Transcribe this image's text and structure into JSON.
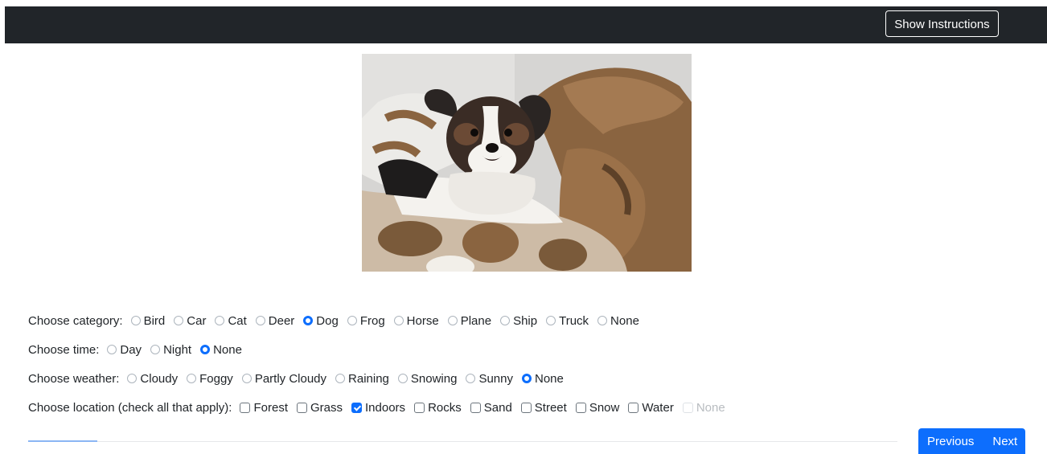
{
  "header": {
    "instructions_button": "Show Instructions"
  },
  "image": {
    "subject": "dog lying on brown blanket"
  },
  "questions": [
    {
      "label": "Choose category:",
      "type": "radio",
      "options": [
        {
          "text": "Bird",
          "checked": false
        },
        {
          "text": "Car",
          "checked": false
        },
        {
          "text": "Cat",
          "checked": false
        },
        {
          "text": "Deer",
          "checked": false
        },
        {
          "text": "Dog",
          "checked": true
        },
        {
          "text": "Frog",
          "checked": false
        },
        {
          "text": "Horse",
          "checked": false
        },
        {
          "text": "Plane",
          "checked": false
        },
        {
          "text": "Ship",
          "checked": false
        },
        {
          "text": "Truck",
          "checked": false
        },
        {
          "text": "None",
          "checked": false
        }
      ]
    },
    {
      "label": "Choose time:",
      "type": "radio",
      "options": [
        {
          "text": "Day",
          "checked": false
        },
        {
          "text": "Night",
          "checked": false
        },
        {
          "text": "None",
          "checked": true
        }
      ]
    },
    {
      "label": "Choose weather:",
      "type": "radio",
      "options": [
        {
          "text": "Cloudy",
          "checked": false
        },
        {
          "text": "Foggy",
          "checked": false
        },
        {
          "text": "Partly Cloudy",
          "checked": false
        },
        {
          "text": "Raining",
          "checked": false
        },
        {
          "text": "Snowing",
          "checked": false
        },
        {
          "text": "Sunny",
          "checked": false
        },
        {
          "text": "None",
          "checked": true
        }
      ]
    },
    {
      "label": "Choose location (check all that apply):",
      "type": "checkbox",
      "options": [
        {
          "text": "Forest",
          "checked": false
        },
        {
          "text": "Grass",
          "checked": false
        },
        {
          "text": "Indoors",
          "checked": true
        },
        {
          "text": "Rocks",
          "checked": false
        },
        {
          "text": "Sand",
          "checked": false
        },
        {
          "text": "Street",
          "checked": false
        },
        {
          "text": "Snow",
          "checked": false
        },
        {
          "text": "Water",
          "checked": false
        },
        {
          "text": "None",
          "checked": false,
          "disabled": true
        }
      ]
    }
  ],
  "progress": {
    "fraction": 0.08
  },
  "nav": {
    "previous": "Previous",
    "next": "Next"
  },
  "colors": {
    "topbar": "#212529",
    "accent": "#0d6efd",
    "progress": "#8bb6f4"
  }
}
